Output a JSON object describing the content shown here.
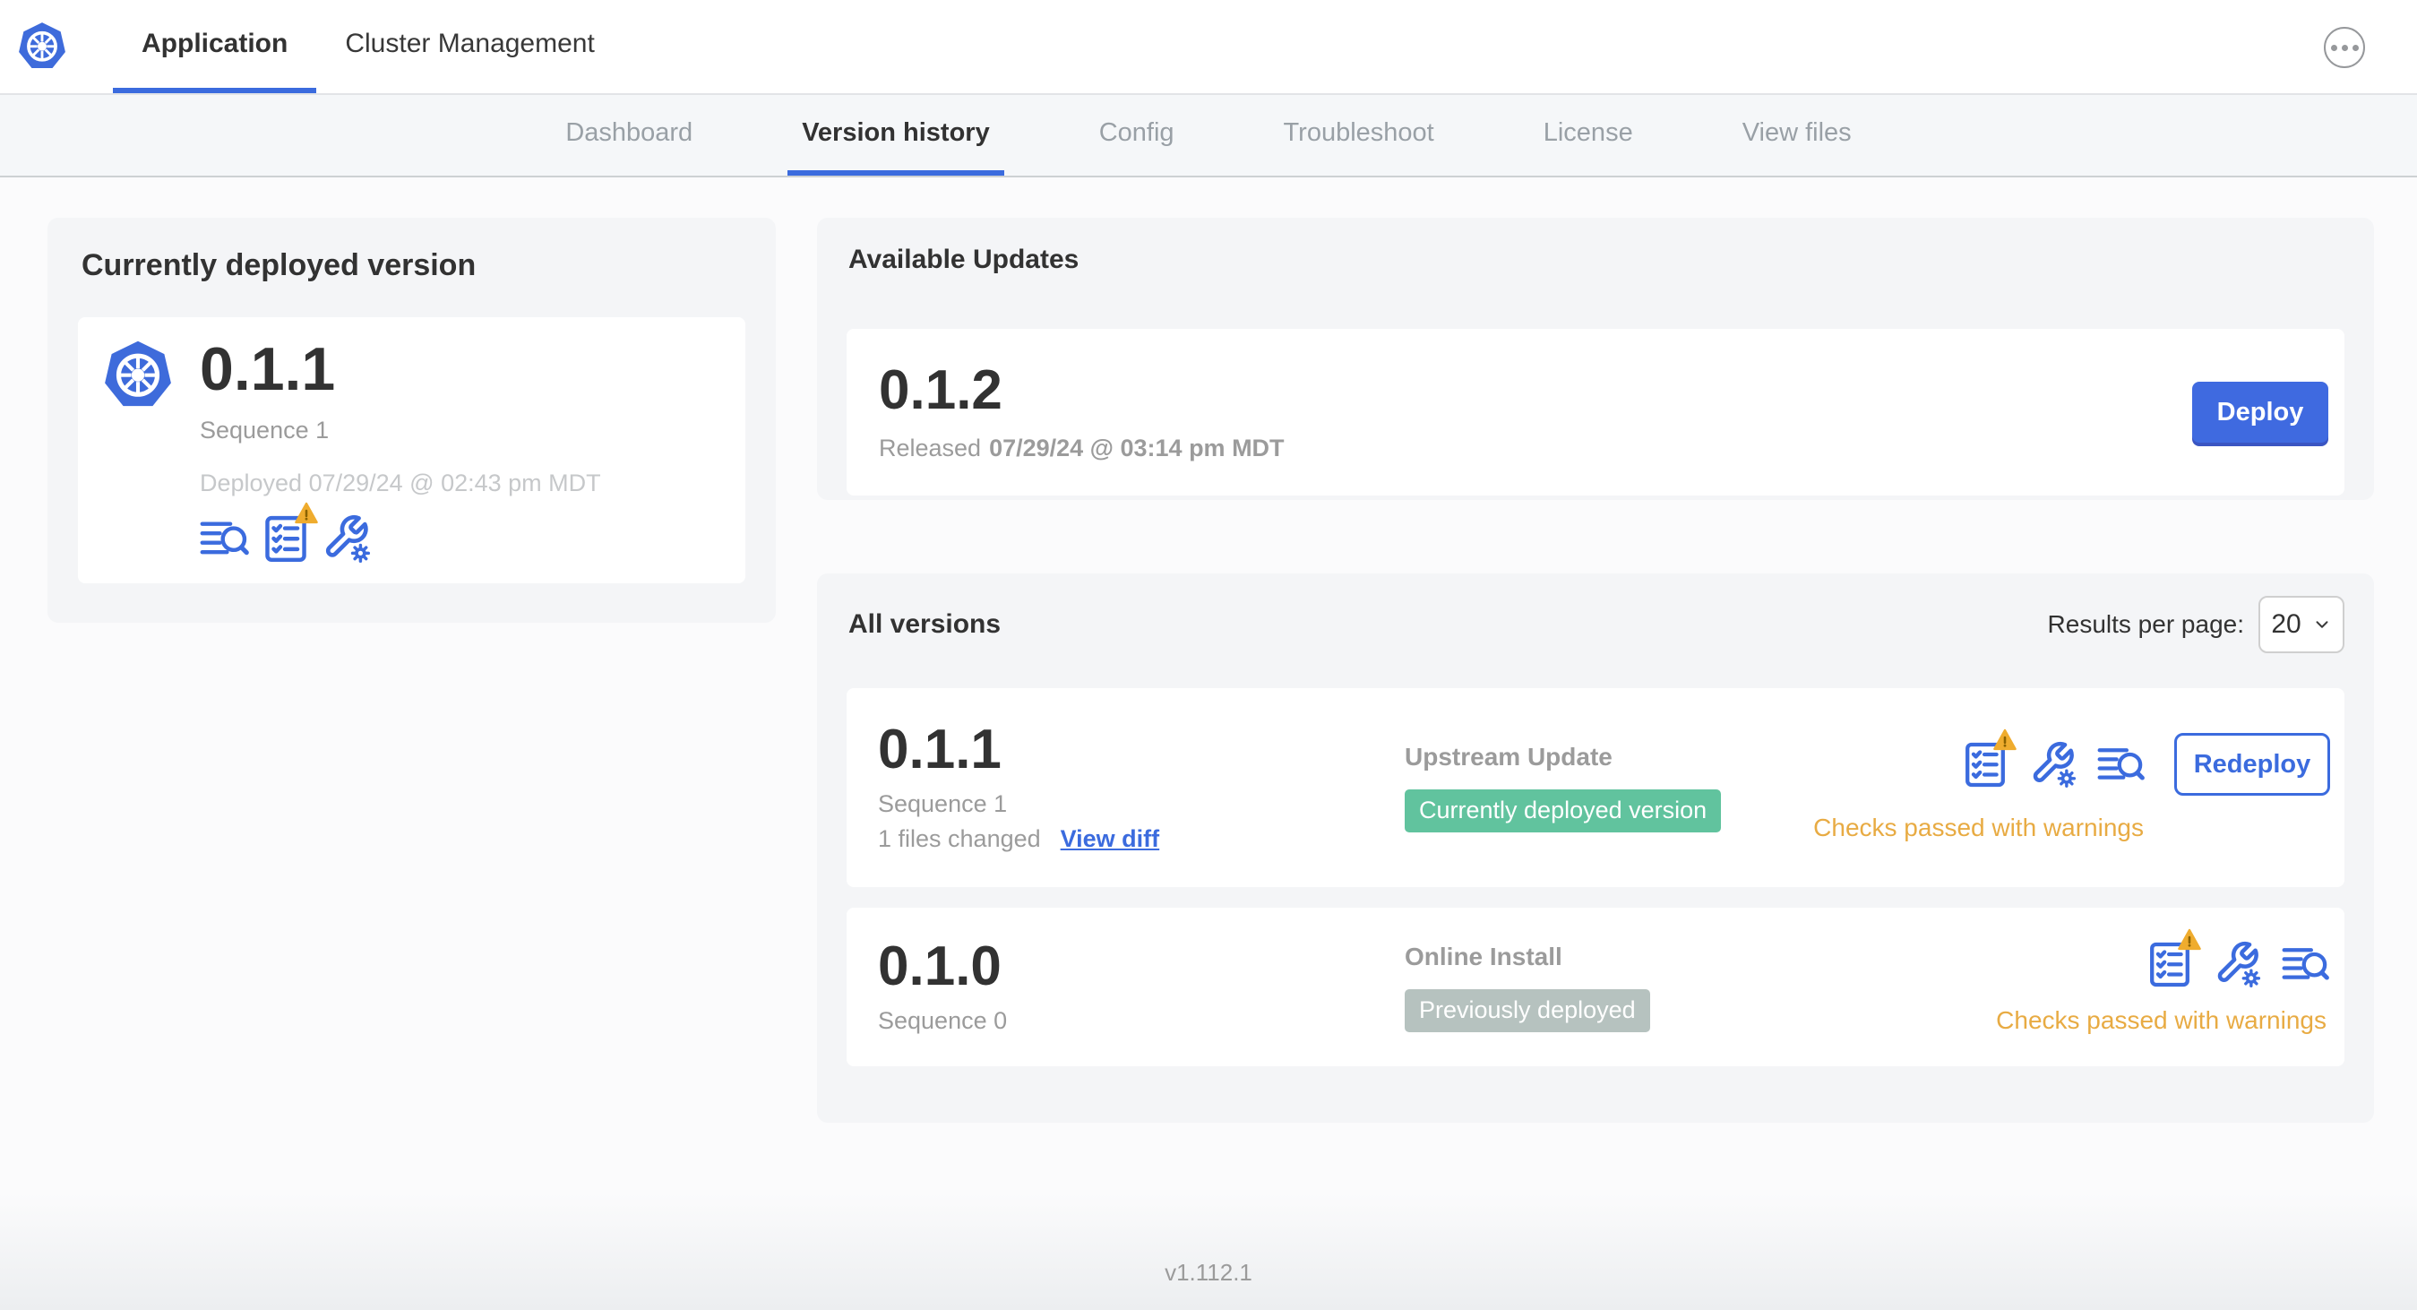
{
  "topbar": {
    "tabs": [
      {
        "label": "Application"
      },
      {
        "label": "Cluster Management"
      }
    ]
  },
  "subnav": {
    "items": [
      {
        "label": "Dashboard"
      },
      {
        "label": "Version history"
      },
      {
        "label": "Config"
      },
      {
        "label": "Troubleshoot"
      },
      {
        "label": "License"
      },
      {
        "label": "View files"
      }
    ],
    "active_item": "Version history"
  },
  "deployed_card": {
    "title": "Currently deployed version",
    "version": "0.1.1",
    "sequence": "Sequence 1",
    "deployed_at": "Deployed 07/29/24 @ 02:43 pm MDT"
  },
  "available_updates": {
    "title": "Available Updates",
    "version": "0.1.2",
    "released_label": "Released",
    "released_at": "07/29/24 @ 03:14 pm MDT",
    "deploy_button": "Deploy"
  },
  "all_versions": {
    "title": "All versions",
    "results_per_page_label": "Results per page:",
    "results_per_page_value": "20",
    "rows": [
      {
        "version": "0.1.1",
        "sequence": "Sequence 1",
        "files_changed": "1 files changed",
        "view_diff_link": "View diff",
        "source": "Upstream Update",
        "badge": "Currently deployed version",
        "badge_type": "green",
        "status": "Checks passed with warnings",
        "action_button": "Redeploy"
      },
      {
        "version": "0.1.0",
        "sequence": "Sequence 0",
        "source": "Online Install",
        "badge": "Previously deployed",
        "badge_type": "gray",
        "status": "Checks passed with warnings"
      }
    ]
  },
  "footer": {
    "app_version": "v1.112.1"
  },
  "icons": {
    "brand": "kubernetes-logo",
    "release_notes": "lines-with-magnifier",
    "preflight_checks": "checklist-with-warning-triangle",
    "config": "wrench-with-gear",
    "more_menu": "ellipsis-in-circle",
    "select_caret": "chevron-down"
  },
  "colors": {
    "accent_blue": "#3b6bde",
    "kubernetes_blue": "#3e6bdb",
    "badge_green": "#61c39e",
    "badge_gray": "#b6c2bf",
    "warning_text": "#e8ab43",
    "warning_triangle": "#efac2e"
  }
}
